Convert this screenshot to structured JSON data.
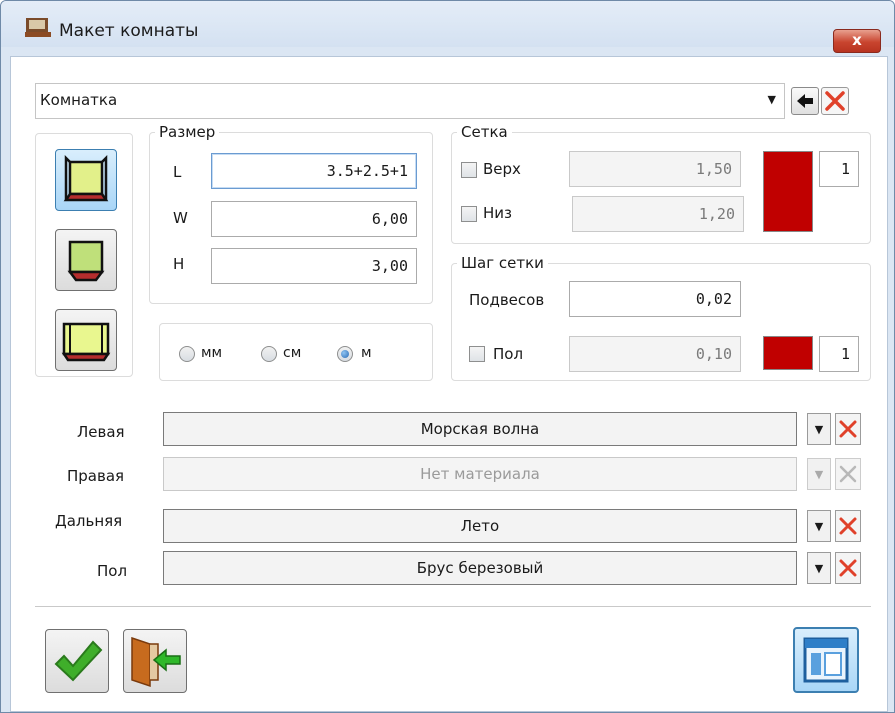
{
  "window": {
    "title": "Макет комнаты",
    "close_label": "x"
  },
  "preset": {
    "value": "Комнатка"
  },
  "size": {
    "group_label": "Размер",
    "fields": [
      {
        "label": "L",
        "value": "3.5+2.5+1"
      },
      {
        "label": "W",
        "value": "6,00"
      },
      {
        "label": "H",
        "value": "3,00"
      }
    ]
  },
  "units": {
    "options": [
      "мм",
      "см",
      "м"
    ],
    "selected": "м"
  },
  "grid": {
    "group_label": "Сетка",
    "top": {
      "label": "Верх",
      "value": "1,50",
      "checked": false
    },
    "bottom": {
      "label": "Низ",
      "value": "1,20",
      "checked": false
    },
    "color": "#c00000",
    "line_width": "1"
  },
  "grid_step": {
    "group_label": "Шаг сетки",
    "suspension": {
      "label": "Подвесов",
      "value": "0,02"
    },
    "floor": {
      "label": "Пол",
      "value": "0,10",
      "checked": false
    },
    "color": "#c00000",
    "line_width": "1"
  },
  "materials": [
    {
      "label": "Левая",
      "value": "Морская волна",
      "enabled": true
    },
    {
      "label": "Правая",
      "value": "Нет материала",
      "enabled": false
    },
    {
      "label": "Дальняя",
      "value": "Лето",
      "enabled": true
    },
    {
      "label": "Пол",
      "value": "Брус березовый",
      "enabled": true
    }
  ],
  "colors": {
    "accent_red": "#c00000",
    "check_green": "#3fae2a",
    "x_red": "#e0412a"
  }
}
